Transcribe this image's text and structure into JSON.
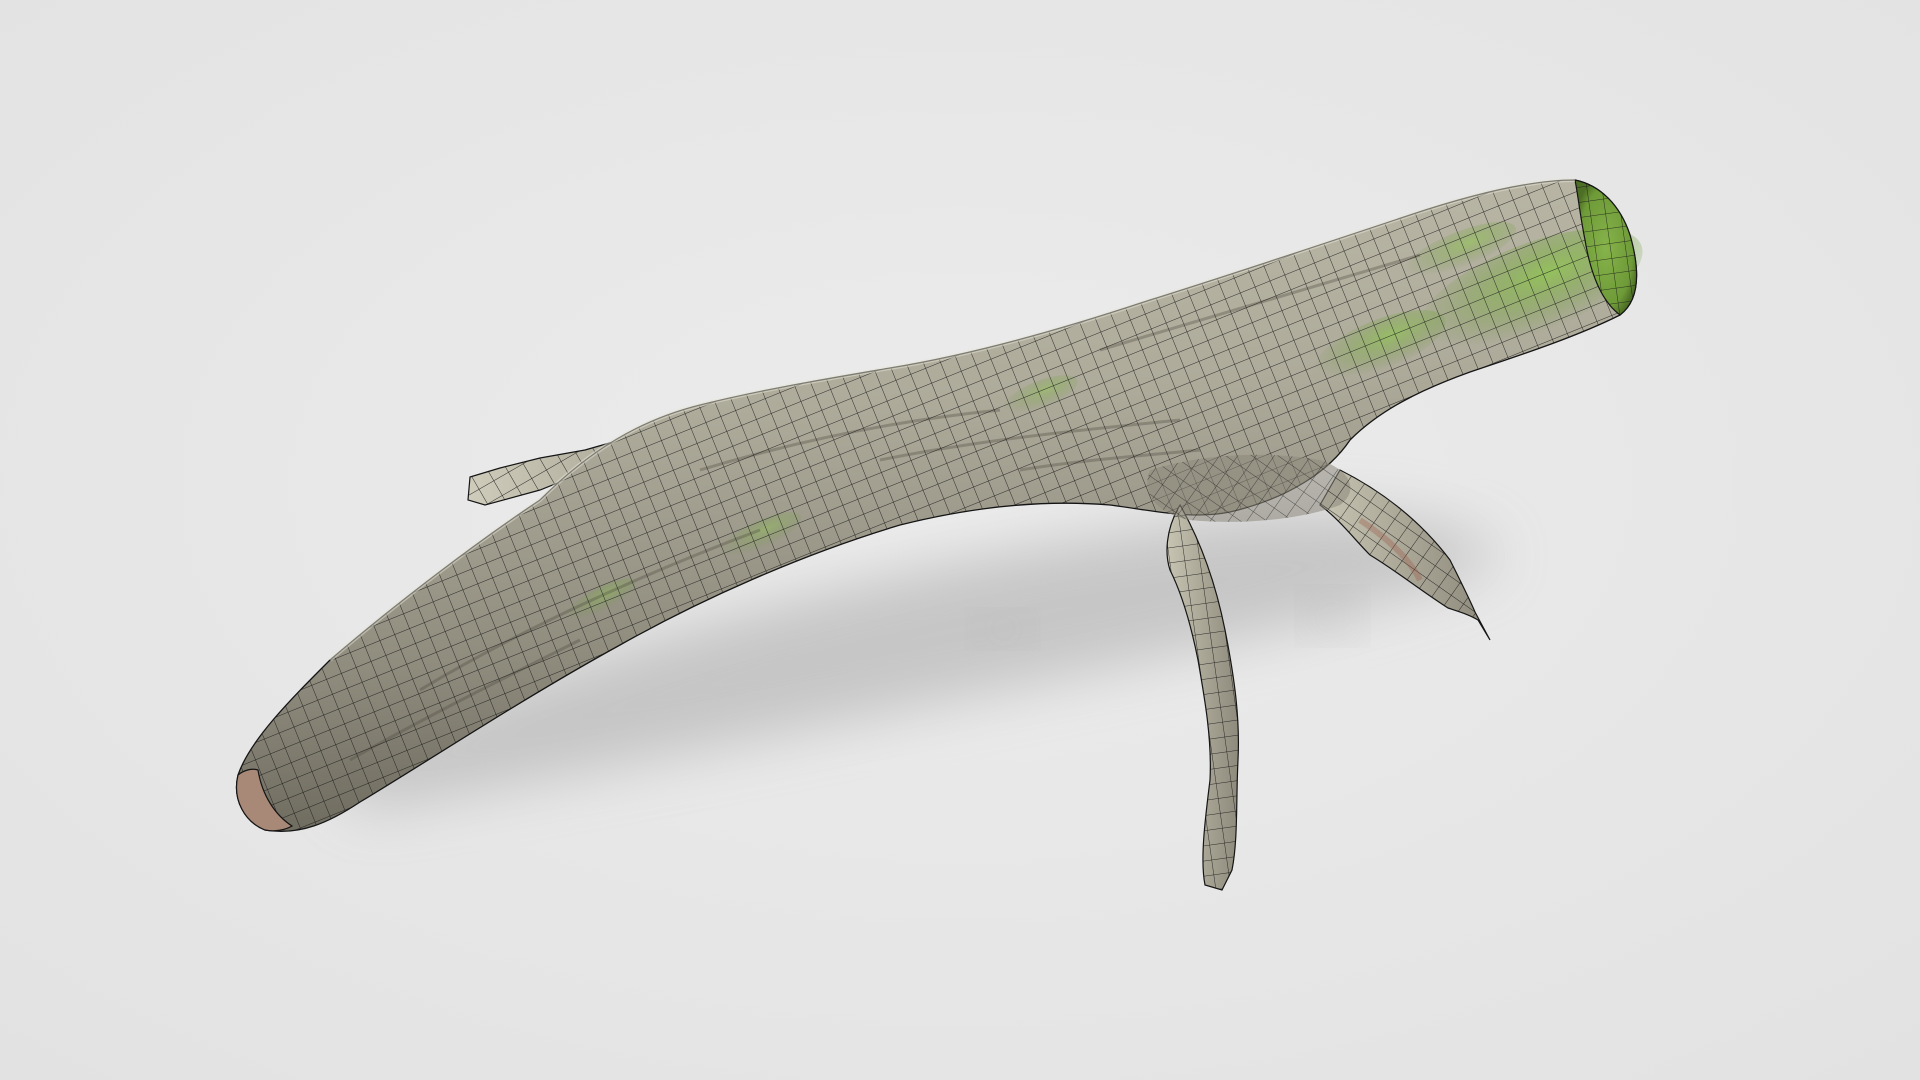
{
  "viewer": {
    "background_color": "#e2e2e2",
    "background_highlight": "#ececec",
    "model_subject": "tree-branch-log",
    "render_mode": "textured-with-wireframe",
    "texture": {
      "bark_base": "#9c9a8c",
      "bark_light": "#c9c6b6",
      "bark_dark": "#5e5a4e",
      "moss": "#7fb443",
      "moss_dark": "#5e8a2c",
      "end_cap_pink": "#b08a7a"
    },
    "wireframe_color": "#151515",
    "shadow_color": "#bdbdbd"
  }
}
